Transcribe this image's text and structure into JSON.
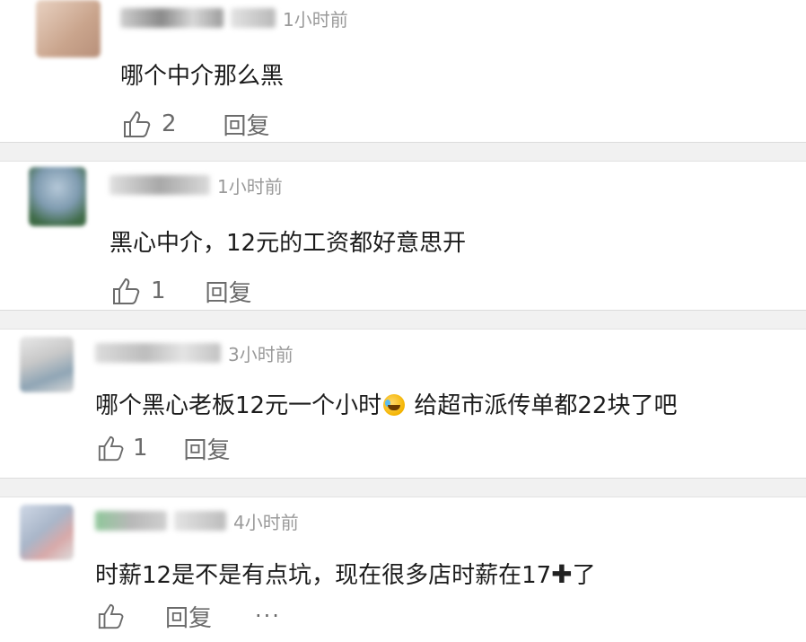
{
  "comments": [
    {
      "username": "",
      "time": "1小时前",
      "text": "哪个中介那么黑",
      "likes": "2",
      "reply_label": "回复"
    },
    {
      "username": "",
      "time": "1小时前",
      "text": "黑心中介，12元的工资都好意思开",
      "likes": "1",
      "reply_label": "回复"
    },
    {
      "username": "",
      "time": "3小时前",
      "text_before_emoji": "哪个黑心老板12元一个小时",
      "text_after_emoji": " 给超市派传单都22块了吧",
      "emoji": "laughing-tears-emoji",
      "likes": "1",
      "reply_label": "回复"
    },
    {
      "username": "",
      "time": "4小时前",
      "text_before_glyph": "时薪12是不是有点坑，现在很多店时薪在17",
      "glyph": "✚",
      "text_after_glyph": "了",
      "likes": "",
      "reply_label": "回复",
      "more_label": "···"
    }
  ],
  "colors": {
    "divider": "#f1f1f1",
    "secondary_text": "#6b6b6b",
    "time_text": "#9a9a9a"
  }
}
